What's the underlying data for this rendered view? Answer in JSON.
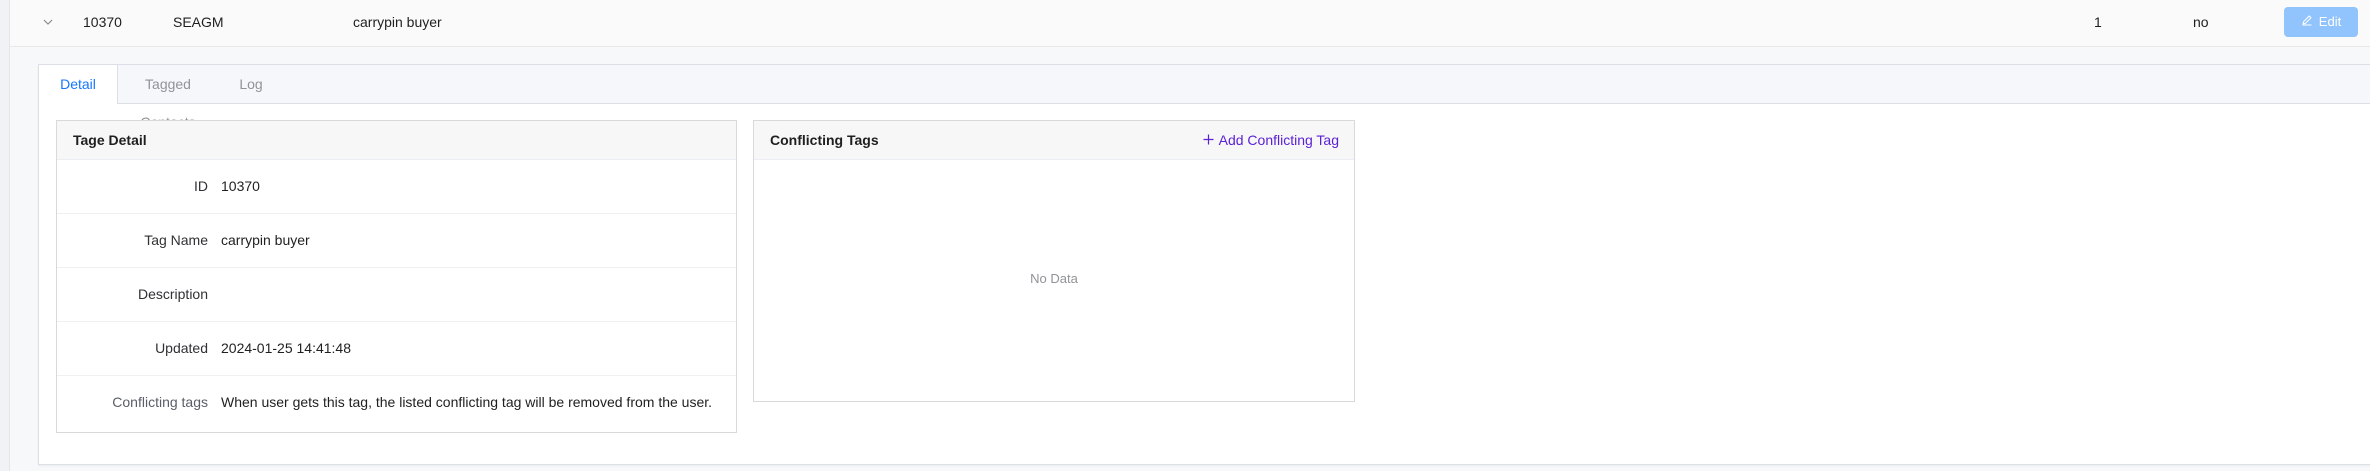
{
  "row": {
    "id": "10370",
    "code": "SEAGM",
    "name": "carrypin buyer",
    "count": "1",
    "flag": "no",
    "edit_label": "Edit"
  },
  "tabs": [
    "Detail",
    "Tagged Contacts",
    "Log"
  ],
  "detail": {
    "title": "Tage Detail",
    "fields": [
      {
        "label": "ID",
        "value": "10370"
      },
      {
        "label": "Tag Name",
        "value": "carrypin buyer"
      },
      {
        "label": "Description",
        "value": ""
      },
      {
        "label": "Updated",
        "value": "2024-01-25 14:41:48"
      },
      {
        "label": "Conflicting tags",
        "value": "When user gets this tag, the listed conflicting tag will be removed from the user."
      }
    ]
  },
  "conflicting": {
    "title": "Conflicting Tags",
    "add_label": "Add Conflicting Tag",
    "empty_text": "No Data"
  },
  "colors": {
    "accent": "#1677ff",
    "edit_button_bg": "#91c3fc",
    "add_link": "#5b21d6"
  },
  "icons": {
    "expand": "chevron-down-icon",
    "edit": "edit-pen-icon",
    "add": "plus-icon"
  }
}
